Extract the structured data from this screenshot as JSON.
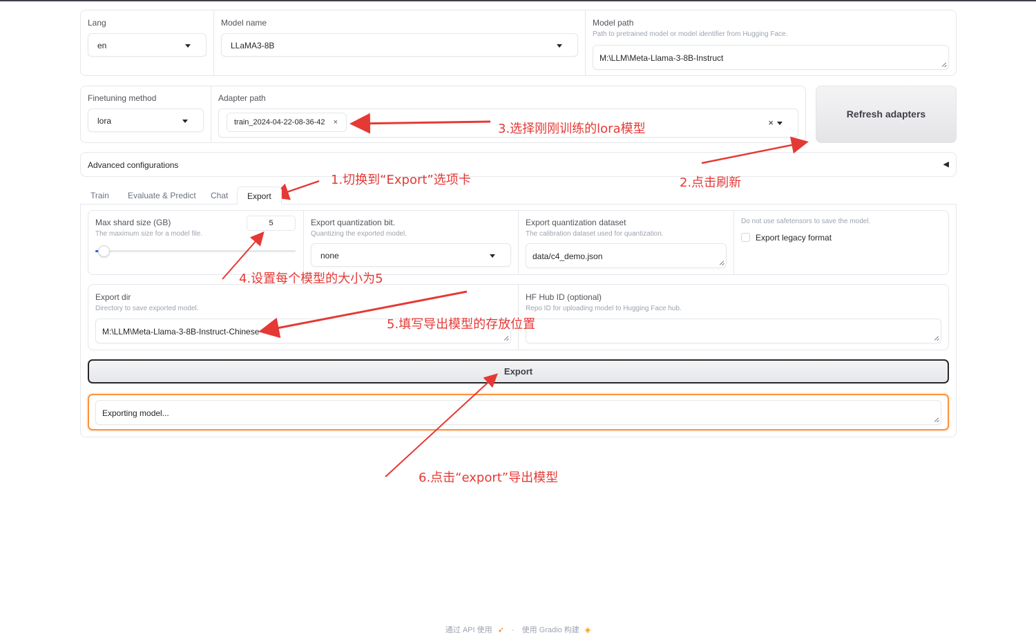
{
  "top_row": {
    "lang": {
      "label": "Lang",
      "value": "en"
    },
    "model_name": {
      "label": "Model name",
      "value": "LLaMA3-8B"
    },
    "model_path": {
      "label": "Model path",
      "info": "Path to pretrained model or model identifier from Hugging Face.",
      "value": "M:\\LLM\\Meta-Llama-3-8B-Instruct"
    }
  },
  "second_row": {
    "finetuning_method": {
      "label": "Finetuning method",
      "value": "lora"
    },
    "adapter_path": {
      "label": "Adapter path",
      "selected": "train_2024-04-22-08-36-42",
      "chip_remove": "×",
      "clear": "×"
    },
    "refresh_button": "Refresh adapters"
  },
  "advanced": {
    "label": "Advanced configurations",
    "toggle": "◀"
  },
  "tabs": [
    {
      "label": "Train",
      "active": false
    },
    {
      "label": "Evaluate & Predict",
      "active": false
    },
    {
      "label": "Chat",
      "active": false
    },
    {
      "label": "Export",
      "active": true
    }
  ],
  "export": {
    "max_shard": {
      "label": "Max shard size (GB)",
      "info": "The maximum size for a model file.",
      "value": "5",
      "slider_fraction": 0.04
    },
    "quant_bit": {
      "label": "Export quantization bit.",
      "info": "Quantizing the exported model.",
      "value": "none"
    },
    "quant_dataset": {
      "label": "Export quantization dataset",
      "info": "The calibration dataset used for quantization.",
      "value": "data/c4_demo.json"
    },
    "legacy": {
      "info": "Do not use safetensors to save the model.",
      "label": "Export legacy format",
      "checked": false
    },
    "export_dir": {
      "label": "Export dir",
      "info": "Directory to save exported model.",
      "value": "M:\\LLM\\Meta-Llama-3-8B-Instruct-Chinese"
    },
    "hub_id": {
      "label": "HF Hub ID (optional)",
      "info": "Repo ID for uploading model to Hugging Face hub.",
      "value": ""
    },
    "export_button": "Export",
    "status": "Exporting model..."
  },
  "annotations": {
    "a1": "1.切换到“Export”选项卡",
    "a2": "2.点击刷新",
    "a3": "3.选择刚刚训练的lora模型",
    "a4": "4.设置每个模型的大小为5",
    "a5": "5.填写导出模型的存放位置",
    "a6": "6.点击“export”导出模型",
    "color": "#e53935"
  },
  "footer": {
    "api": "通过 API 使用",
    "separator": "·",
    "built": "使用 Gradio 构建",
    "api_icon": "rocket-icon",
    "built_icon": "gradio-logo-icon"
  }
}
